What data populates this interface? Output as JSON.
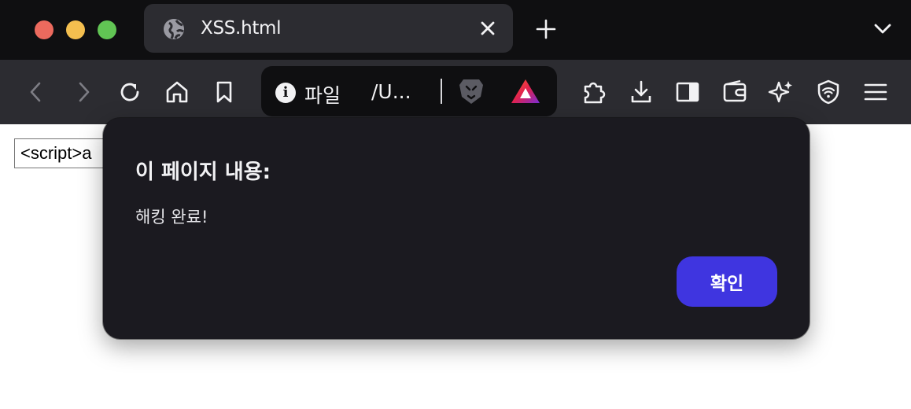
{
  "window": {
    "controls": [
      "close",
      "minimize",
      "zoom"
    ],
    "colors": {
      "close": "#ec6a5e",
      "minimize": "#f4bf4f",
      "zoom": "#61c554"
    }
  },
  "tab": {
    "title": "XSS.html",
    "icon": "globe-icon"
  },
  "toolbar": {
    "icons": [
      "back-icon",
      "forward-icon",
      "reload-icon",
      "home-icon",
      "bookmark-icon",
      "extensions-icon",
      "download-icon",
      "sidebar-icon",
      "wallet-icon",
      "leo-ai-icon",
      "vpn-icon",
      "menu-icon"
    ]
  },
  "urlbar": {
    "scheme_label": "파일",
    "path": "/U..."
  },
  "page": {
    "input_value": "<script>a"
  },
  "dialog": {
    "title": "이 페이지 내용:",
    "message": "해킹 완료!",
    "ok_label": "확인",
    "accent_color": "#3f35e0"
  }
}
